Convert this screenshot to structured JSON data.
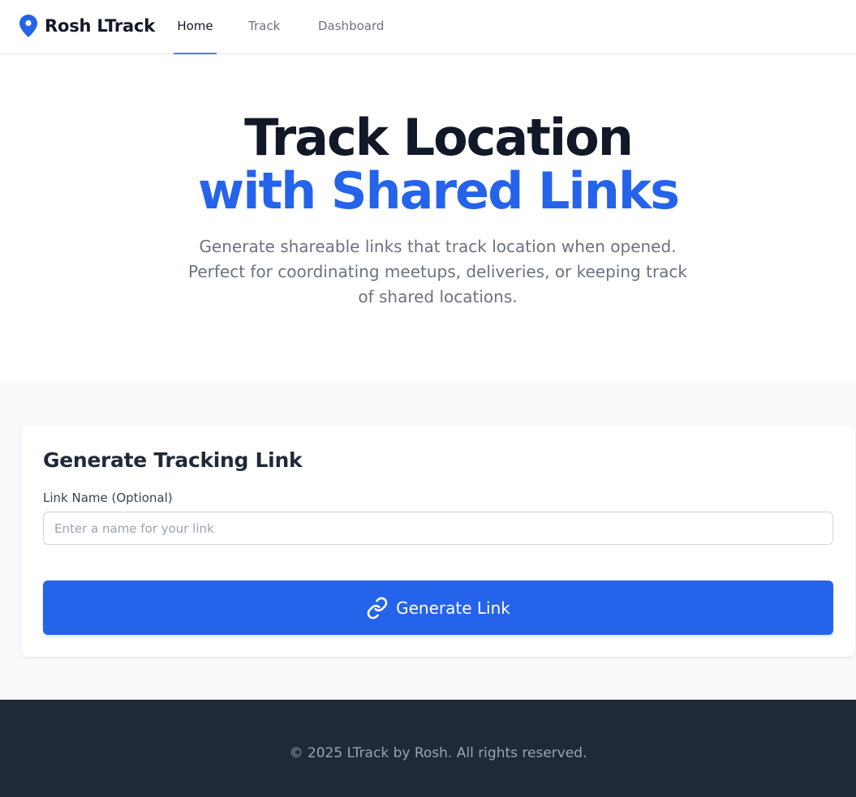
{
  "header": {
    "brand_name": "Rosh LTrack",
    "brand_icon": "map-pin-icon",
    "nav": [
      {
        "label": "Home",
        "active": true
      },
      {
        "label": "Track",
        "active": false
      },
      {
        "label": "Dashboard",
        "active": false
      }
    ]
  },
  "hero": {
    "title_line1": "Track Location",
    "title_line2": "with Shared Links",
    "subtitle": "Generate shareable links that track location when opened. Perfect for coordinating meetups, deliveries, or keeping track of shared locations."
  },
  "generator": {
    "title": "Generate Tracking Link",
    "field_label": "Link Name (Optional)",
    "input_value": "",
    "input_placeholder": "Enter a name for your link",
    "button_label": "Generate Link",
    "button_icon": "link-icon"
  },
  "footer": {
    "text": "© 2025 LTrack by Rosh. All rights reserved."
  },
  "colors": {
    "accent": "#2563eb",
    "dark": "#111827",
    "footer_bg": "#1f2937",
    "muted": "#6b7280"
  }
}
